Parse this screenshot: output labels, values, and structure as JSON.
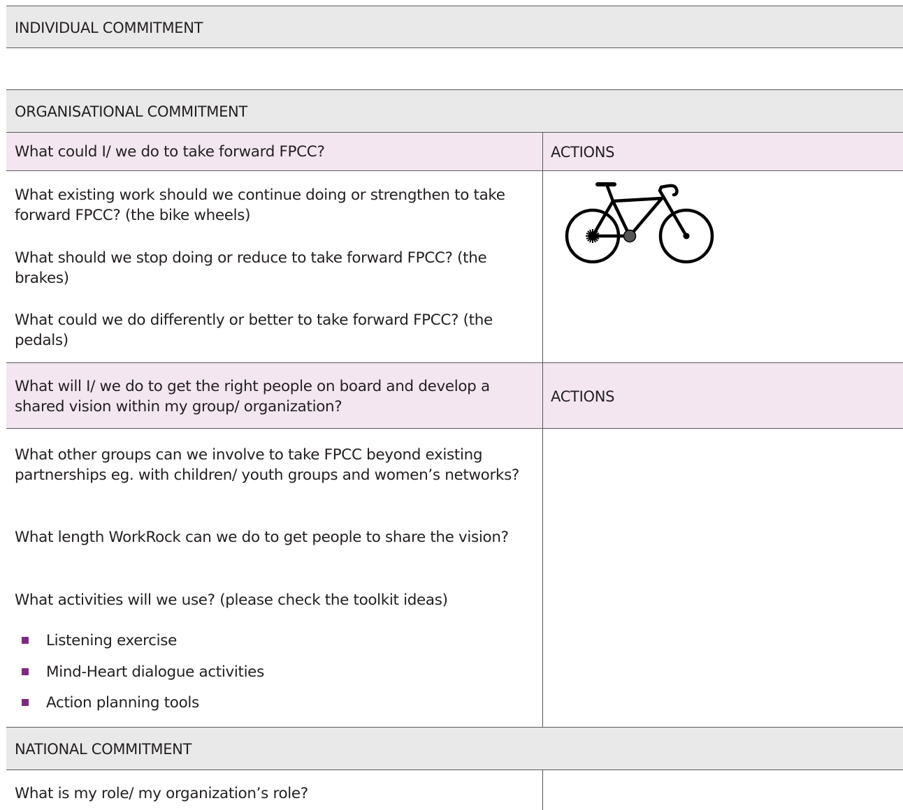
{
  "individual": {
    "title": "INDIVIDUAL COMMITMENT"
  },
  "organisational": {
    "title": "ORGANISATIONAL COMMITMENT",
    "q1": {
      "header": "What could I/ we do to take forward FPCC?",
      "actions_label": "ACTIONS",
      "items": [
        "What existing work should we continue doing or strengthen to take forward FPCC? (the bike wheels)",
        "What should we stop doing or reduce to take forward FPCC? (the brakes)",
        "What could we do differently or better to take forward FPCC? (the pedals)"
      ],
      "image_icon": "bicycle-icon"
    },
    "q2": {
      "header": "What will I/ we do to get the right people on board and develop a shared vision within my group/ organization?",
      "actions_label": "ACTIONS",
      "items": [
        "What other groups can we involve to take FPCC beyond existing partnerships eg. with children/ youth groups and women’s networks?",
        "What length WorkRock can we do to get people to share the vision?",
        "What activities will we use? (please check the toolkit ideas)"
      ],
      "bullets": [
        "Listening exercise",
        "Mind-Heart dialogue activities",
        "Action planning tools"
      ],
      "bullet_color": "#7b2d7c"
    }
  },
  "national": {
    "title": "NATIONAL COMMITMENT",
    "q1": "What is my role/ my organization’s role?"
  },
  "colors": {
    "section_bg": "#e9e9ea",
    "question_bg": "#f3e6f0",
    "rule": "#5a5a5a"
  }
}
